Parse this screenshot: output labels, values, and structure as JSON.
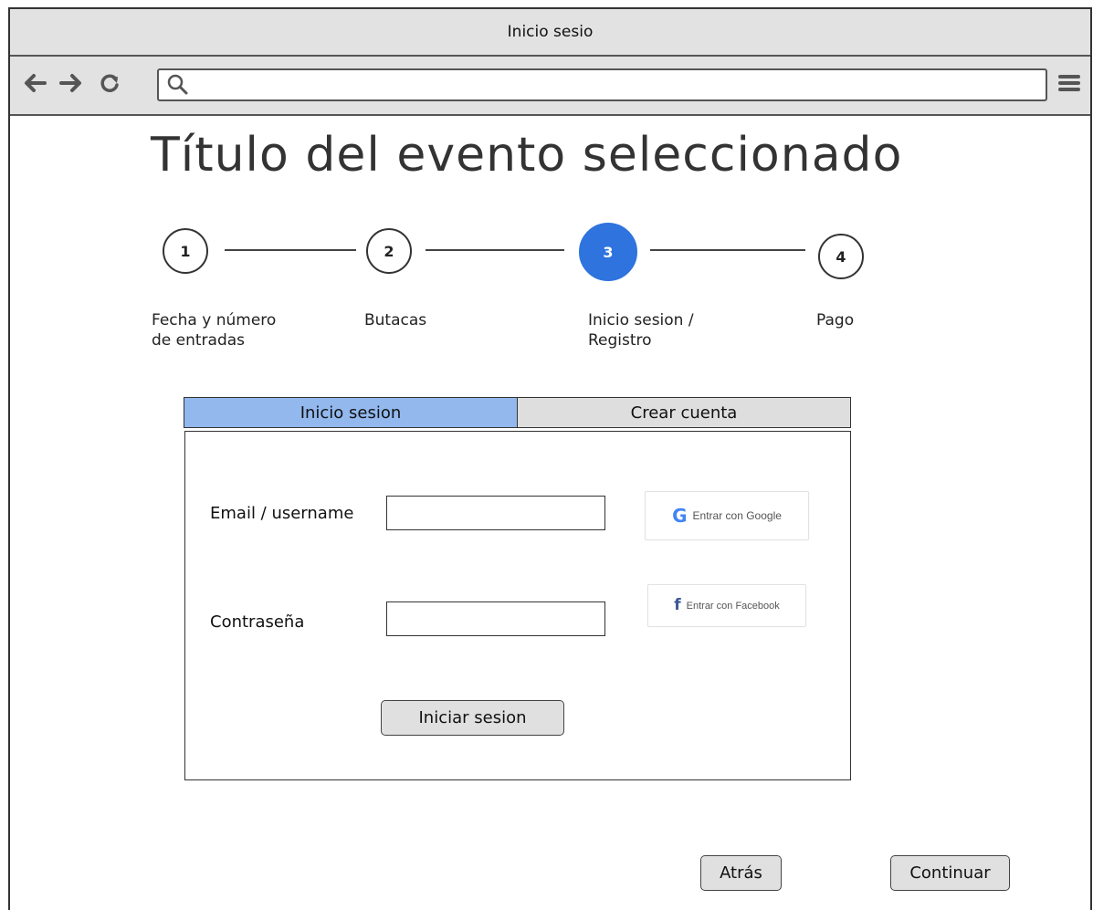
{
  "window": {
    "title": "Inicio sesio"
  },
  "toolbar": {
    "back_icon": "arrow-left-icon",
    "forward_icon": "arrow-right-icon",
    "reload_icon": "reload-icon",
    "search_icon": "search-icon",
    "menu_icon": "hamburger-menu-icon",
    "url_value": ""
  },
  "page": {
    "title": "Título del evento seleccionado"
  },
  "steps": [
    {
      "number": "1",
      "label_line1": "Fecha y número",
      "label_line2": "de entradas",
      "active": false
    },
    {
      "number": "2",
      "label_line1": "Butacas",
      "label_line2": "",
      "active": false
    },
    {
      "number": "3",
      "label_line1": "Inicio sesion /",
      "label_line2": "Registro",
      "active": true
    },
    {
      "number": "4",
      "label_line1": "Pago",
      "label_line2": "",
      "active": false
    }
  ],
  "tabs": [
    {
      "label": "Inicio sesion",
      "active": true
    },
    {
      "label": "Crear cuenta",
      "active": false
    }
  ],
  "login": {
    "email_label": "Email / username",
    "email_value": "",
    "password_label": "Contraseña",
    "password_value": "",
    "submit_label": "Iniciar sesion",
    "google_label": "Entrar con Google",
    "facebook_label": "Entrar con Facebook"
  },
  "footer": {
    "back_label": "Atrás",
    "continue_label": "Continuar"
  },
  "colors": {
    "active_step": "#2e73de",
    "active_tab": "#92b8ee",
    "inactive_tab": "#dedede",
    "chrome": "#e2e2e2",
    "facebook_blue": "#3b5998"
  }
}
